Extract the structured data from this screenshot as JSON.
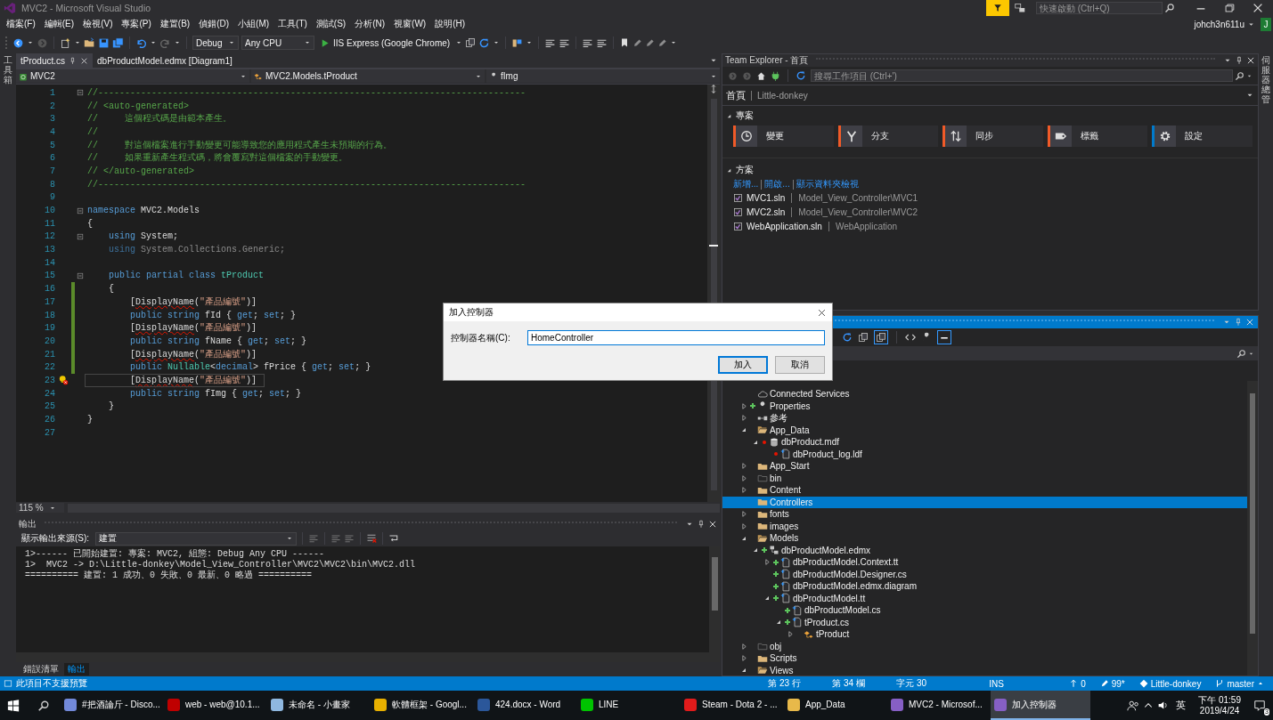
{
  "window": {
    "title": "MVC2 - Microsoft Visual Studio",
    "quick_launch": {
      "placeholder": "快速啟動 (Ctrl+Q)"
    },
    "user": "johch3n611u",
    "avatar": "J"
  },
  "menu": [
    "檔案(F)",
    "編輯(E)",
    "檢視(V)",
    "專案(P)",
    "建置(B)",
    "偵錯(D)",
    "小組(M)",
    "工具(T)",
    "測試(S)",
    "分析(N)",
    "視窗(W)",
    "說明(H)"
  ],
  "toolbar": {
    "configuration": "Debug",
    "platform": "Any CPU",
    "run": "IIS Express (Google Chrome)"
  },
  "left_strip": "工具箱",
  "right_strip": "伺服器總管",
  "editor": {
    "tabs": [
      {
        "label": "tProduct.cs",
        "selected": true
      },
      {
        "label": "dbProductModel.edmx [Diagram1]",
        "selected": false
      }
    ],
    "nav": [
      "MVC2",
      "MVC2.Models.tProduct",
      "fImg"
    ],
    "lines": [
      {
        "n": "1",
        "fold": true,
        "tokens": [
          {
            "kind": "comment",
            "text": "//--------------------------------------------------------------------------------"
          }
        ]
      },
      {
        "n": "2",
        "tokens": [
          {
            "kind": "comment",
            "text": "// <auto-generated>"
          }
        ]
      },
      {
        "n": "3",
        "tokens": [
          {
            "kind": "comment",
            "text": "//     這個程式碼是由範本產生。"
          }
        ]
      },
      {
        "n": "4",
        "tokens": [
          {
            "kind": "comment",
            "text": "//"
          }
        ]
      },
      {
        "n": "5",
        "tokens": [
          {
            "kind": "comment",
            "text": "//     對這個檔案進行手動變更可能導致您的應用程式產生未預期的行為。"
          }
        ]
      },
      {
        "n": "6",
        "tokens": [
          {
            "kind": "comment",
            "text": "//     如果重新產生程式碼，將會覆寫對這個檔案的手動變更。"
          }
        ]
      },
      {
        "n": "7",
        "tokens": [
          {
            "kind": "comment",
            "text": "// </auto-generated>"
          }
        ]
      },
      {
        "n": "8",
        "tokens": [
          {
            "kind": "comment",
            "text": "//--------------------------------------------------------------------------------"
          }
        ]
      },
      {
        "n": "9"
      },
      {
        "n": "10",
        "fold": true,
        "tokens": [
          {
            "kind": "keyword",
            "text": "namespace"
          },
          {
            "kind": "plain",
            "text": " MVC2.Models"
          }
        ]
      },
      {
        "n": "11",
        "tokens": [
          {
            "kind": "plain",
            "text": "{"
          }
        ]
      },
      {
        "n": "12",
        "fold": true,
        "tokens": [
          {
            "kind": "keyword",
            "text": "    using"
          },
          {
            "kind": "plain",
            "text": " System;"
          }
        ]
      },
      {
        "n": "13",
        "tokens": [
          {
            "kind": "keyword-dim",
            "text": "    using"
          },
          {
            "kind": "dim",
            "text": " System.Collections.Generic;"
          }
        ]
      },
      {
        "n": "14"
      },
      {
        "n": "15",
        "fold": true,
        "tokens": [
          {
            "kind": "keyword",
            "text": "    public partial class"
          },
          {
            "kind": "type",
            "text": " tProduct"
          }
        ]
      },
      {
        "n": "16",
        "changed": true,
        "tokens": [
          {
            "kind": "plain",
            "text": "    {"
          }
        ]
      },
      {
        "n": "17",
        "changed": true,
        "tokens": [
          {
            "kind": "plain",
            "text": "        ["
          },
          {
            "kind": "squiggle",
            "text": "DisplayName"
          },
          {
            "kind": "plain",
            "text": "("
          },
          {
            "kind": "string",
            "text": "\"產品編號\""
          },
          {
            "kind": "plain",
            "text": ")]"
          }
        ]
      },
      {
        "n": "18",
        "changed": true,
        "tokens": [
          {
            "kind": "keyword",
            "text": "        public string"
          },
          {
            "kind": "plain",
            "text": " fId { "
          },
          {
            "kind": "keyword",
            "text": "get"
          },
          {
            "kind": "plain",
            "text": "; "
          },
          {
            "kind": "keyword",
            "text": "set"
          },
          {
            "kind": "plain",
            "text": "; }"
          }
        ]
      },
      {
        "n": "19",
        "changed": true,
        "tokens": [
          {
            "kind": "plain",
            "text": "        ["
          },
          {
            "kind": "squiggle",
            "text": "DisplayName"
          },
          {
            "kind": "plain",
            "text": "("
          },
          {
            "kind": "string",
            "text": "\"產品編號\""
          },
          {
            "kind": "plain",
            "text": ")]"
          }
        ]
      },
      {
        "n": "20",
        "changed": true,
        "tokens": [
          {
            "kind": "keyword",
            "text": "        public string"
          },
          {
            "kind": "plain",
            "text": " fName { "
          },
          {
            "kind": "keyword",
            "text": "get"
          },
          {
            "kind": "plain",
            "text": "; "
          },
          {
            "kind": "keyword",
            "text": "set"
          },
          {
            "kind": "plain",
            "text": "; }"
          }
        ]
      },
      {
        "n": "21",
        "changed": true,
        "tokens": [
          {
            "kind": "plain",
            "text": "        ["
          },
          {
            "kind": "squiggle",
            "text": "DisplayName"
          },
          {
            "kind": "plain",
            "text": "("
          },
          {
            "kind": "string",
            "text": "\"產品編號\""
          },
          {
            "kind": "plain",
            "text": ")]"
          }
        ]
      },
      {
        "n": "22",
        "changed": true,
        "tokens": [
          {
            "kind": "keyword",
            "text": "        public"
          },
          {
            "kind": "type",
            "text": " Nullable"
          },
          {
            "kind": "plain",
            "text": "<"
          },
          {
            "kind": "keyword",
            "text": "decimal"
          },
          {
            "kind": "plain",
            "text": "> fPrice { "
          },
          {
            "kind": "keyword",
            "text": "get"
          },
          {
            "kind": "plain",
            "text": "; "
          },
          {
            "kind": "keyword",
            "text": "set"
          },
          {
            "kind": "plain",
            "text": "; }"
          }
        ]
      },
      {
        "n": "23",
        "current": true,
        "tokens": [
          {
            "kind": "plain",
            "text": "        ["
          },
          {
            "kind": "squiggle",
            "text": "DisplayName"
          },
          {
            "kind": "plain",
            "text": "("
          },
          {
            "kind": "string",
            "text": "\"產品編號\""
          },
          {
            "kind": "plain",
            "text": ")]"
          }
        ]
      },
      {
        "n": "24",
        "tokens": [
          {
            "kind": "keyword",
            "text": "        public string"
          },
          {
            "kind": "plain",
            "text": " fImg { "
          },
          {
            "kind": "keyword",
            "text": "get"
          },
          {
            "kind": "plain",
            "text": "; "
          },
          {
            "kind": "keyword",
            "text": "set"
          },
          {
            "kind": "plain",
            "text": "; }"
          }
        ]
      },
      {
        "n": "25",
        "tokens": [
          {
            "kind": "plain",
            "text": "    }"
          }
        ]
      },
      {
        "n": "26",
        "tokens": [
          {
            "kind": "plain",
            "text": "}"
          }
        ]
      },
      {
        "n": "27"
      }
    ],
    "zoom": "115 %"
  },
  "output": {
    "title": "輸出",
    "source_label": "顯示輸出來源(S):",
    "source": "建置",
    "lines": [
      "1>------ 已開始建置: 專案: MVC2, 組態: Debug Any CPU ------",
      "1>  MVC2 -> D:\\Little-donkey\\Model_View_Controller\\MVC2\\MVC2\\bin\\MVC2.dll",
      "========== 建置: 1 成功、0 失敗、0 最新、0 略過 =========="
    ]
  },
  "bottom_tabs": [
    {
      "label": "錯誤清單",
      "selected": false
    },
    {
      "label": "輸出",
      "selected": true
    }
  ],
  "team_explorer": {
    "title": "Team Explorer - 首頁",
    "search": {
      "placeholder": "搜尋工作項目 (Ctrl+')"
    },
    "page": "首頁",
    "repo": "Little-donkey",
    "project_heading": "專案",
    "tiles": [
      {
        "kind": "changes",
        "label": "變更",
        "color": "#f05a28"
      },
      {
        "kind": "branches",
        "label": "分支",
        "color": "#f05a28"
      },
      {
        "kind": "sync",
        "label": "同步",
        "color": "#f05a28"
      },
      {
        "kind": "tags",
        "label": "標籤",
        "color": "#f05a28"
      },
      {
        "kind": "settings",
        "label": "設定",
        "color": "#007acc"
      }
    ],
    "solutions_heading": "方案",
    "links": [
      "新增...",
      "開啟...",
      "顯示資料夾檢視"
    ],
    "solutions": [
      {
        "name": "MVC1.sln",
        "path": "Model_View_Controller\\MVC1"
      },
      {
        "name": "MVC2.sln",
        "path": "Model_View_Controller\\MVC2"
      },
      {
        "name": "WebApplication.sln",
        "path": "WebApplication"
      }
    ]
  },
  "solution_explorer": {
    "tree": [
      {
        "label": "Connected Services",
        "kind": "cloud",
        "added": false,
        "error": false,
        "selected": false
      },
      {
        "label": "Properties",
        "kind": "wrench",
        "expanded": false,
        "added": true,
        "error": false,
        "selected": false
      },
      {
        "label": "參考",
        "kind": "refs",
        "expanded": false,
        "added": false,
        "error": false,
        "selected": false
      },
      {
        "label": "App_Data",
        "kind": "folder-open",
        "expanded": true,
        "added": false,
        "error": false,
        "selected": false,
        "children": [
          {
            "label": "dbProduct.mdf",
            "kind": "db",
            "expanded": true,
            "added": false,
            "error": true,
            "selected": false,
            "children": [
              {
                "label": "dbProduct_log.ldf",
                "kind": "file",
                "added": false,
                "error": true,
                "selected": false
              }
            ]
          }
        ]
      },
      {
        "label": "App_Start",
        "kind": "folder",
        "expanded": false,
        "added": false,
        "error": false,
        "selected": false
      },
      {
        "label": "bin",
        "kind": "folder-dim",
        "expanded": false,
        "added": false,
        "error": false,
        "selected": false
      },
      {
        "label": "Content",
        "kind": "folder",
        "expanded": false,
        "added": false,
        "error": false,
        "selected": false
      },
      {
        "label": "Controllers",
        "kind": "folder",
        "added": false,
        "error": false,
        "selected": true
      },
      {
        "label": "fonts",
        "kind": "folder",
        "expanded": false,
        "added": false,
        "error": false,
        "selected": false
      },
      {
        "label": "images",
        "kind": "folder",
        "expanded": false,
        "added": false,
        "error": false,
        "selected": false
      },
      {
        "label": "Models",
        "kind": "folder-open",
        "expanded": true,
        "added": false,
        "error": false,
        "selected": false,
        "children": [
          {
            "label": "dbProductModel.edmx",
            "kind": "edmx",
            "expanded": true,
            "added": true,
            "error": false,
            "selected": false,
            "children": [
              {
                "label": "dbProductModel.Context.tt",
                "kind": "file",
                "expanded": false,
                "added": true,
                "error": false,
                "selected": false
              },
              {
                "label": "dbProductModel.Designer.cs",
                "kind": "file",
                "added": true,
                "error": false,
                "selected": false
              },
              {
                "label": "dbProductModel.edmx.diagram",
                "kind": "file",
                "added": true,
                "error": false,
                "selected": false
              },
              {
                "label": "dbProductModel.tt",
                "kind": "file",
                "expanded": true,
                "added": true,
                "error": false,
                "selected": false,
                "children": [
                  {
                    "label": "dbProductModel.cs",
                    "kind": "file",
                    "added": true,
                    "error": false,
                    "selected": false
                  },
                  {
                    "label": "tProduct.cs",
                    "kind": "file",
                    "expanded": true,
                    "added": true,
                    "error": false,
                    "selected": false,
                    "children": [
                      {
                        "label": "tProduct",
                        "kind": "class",
                        "expanded": false,
                        "added": false,
                        "error": false,
                        "selected": false
                      }
                    ]
                  }
                ]
              }
            ]
          }
        ]
      },
      {
        "label": "obj",
        "kind": "folder-dim",
        "expanded": false,
        "added": false,
        "error": false,
        "selected": false
      },
      {
        "label": "Scripts",
        "kind": "folder",
        "expanded": false,
        "added": false,
        "error": false,
        "selected": false
      },
      {
        "label": "Views",
        "kind": "folder-open",
        "expanded": true,
        "added": false,
        "error": false,
        "selected": false
      }
    ]
  },
  "dialog": {
    "title": "加入控制器",
    "field_label": "控制器名稱(C):",
    "value": "HomeController",
    "buttons": [
      {
        "label": "加入",
        "default": true
      },
      {
        "label": "取消",
        "default": false
      }
    ]
  },
  "status_bar": {
    "message": "此項目不支援預覽",
    "line": "第 23 行",
    "column": "第 34 欄",
    "char": "字元 30",
    "mode": "INS",
    "push": "0",
    "changes": "99*",
    "repo": "Little-donkey",
    "branch": "master"
  },
  "taskbar": {
    "apps": [
      {
        "label": "#把酒論斤 - Disco...",
        "color": "#7289da",
        "selected": false
      },
      {
        "label": "web - web@10.1...",
        "color": "#bf0000",
        "selected": false
      },
      {
        "label": "未命名 - 小畫家",
        "color": "#8fb8e0",
        "selected": false
      },
      {
        "label": "軟體框架 - Googl...",
        "color": "#e8b000",
        "selected": false
      },
      {
        "label": "424.docx - Word",
        "color": "#2b579a",
        "selected": false
      },
      {
        "label": "LINE",
        "color": "#00c300",
        "selected": false
      },
      {
        "label": "Steam - Dota 2 - ...",
        "color": "#e21b1b",
        "selected": false
      },
      {
        "label": "App_Data",
        "color": "#e8b94a",
        "selected": false
      },
      {
        "label": "MVC2 - Microsof...",
        "color": "#865fc5",
        "selected": false
      },
      {
        "label": "加入控制器",
        "color": "#865fc5",
        "selected": true
      }
    ],
    "ime": "英",
    "time": "下午 01:59",
    "date": "2019/4/24",
    "notifications": "3"
  }
}
